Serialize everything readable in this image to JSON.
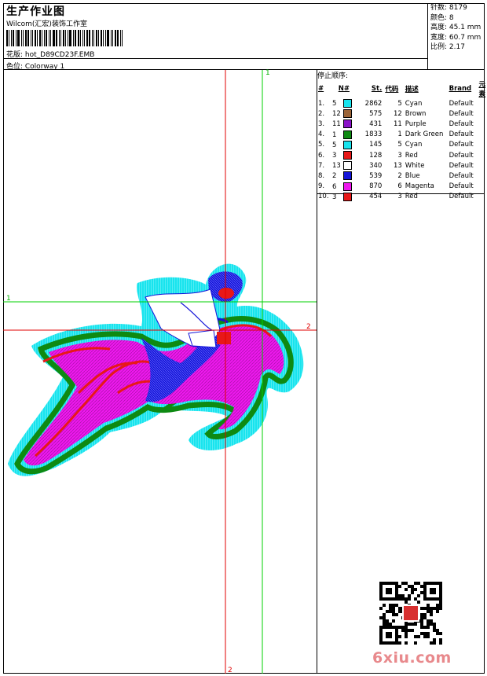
{
  "header": {
    "title": "生产作业图",
    "company": "Wilcom(汇宏)装饰工作室",
    "design_label": "花版: hot_D89CD23F.EMB",
    "colorway_label": "色位: Colorway 1"
  },
  "stats": [
    "针数: 8179",
    "颜色: 8",
    "高度: 45.1 mm",
    "宽度: 60.7 mm",
    "比例: 2.17"
  ],
  "stop_sequence": {
    "title": "停止顺序:",
    "headers": [
      "#",
      "N#",
      "St.",
      "代码",
      "描述",
      "Brand",
      "元素"
    ],
    "rows": [
      {
        "idx": "1.",
        "n": "5",
        "color": "#18e4ee",
        "st": "2862",
        "code": "5",
        "desc": "Cyan",
        "brand": "Default"
      },
      {
        "idx": "2.",
        "n": "12",
        "color": "#9a6438",
        "st": "575",
        "code": "12",
        "desc": "Brown",
        "brand": "Default"
      },
      {
        "idx": "3.",
        "n": "11",
        "color": "#8a12c8",
        "st": "431",
        "code": "11",
        "desc": "Purple",
        "brand": "Default"
      },
      {
        "idx": "4.",
        "n": "1",
        "color": "#0e8a12",
        "st": "1833",
        "code": "1",
        "desc": "Dark Green",
        "brand": "Default"
      },
      {
        "idx": "5.",
        "n": "5",
        "color": "#18e4ee",
        "st": "145",
        "code": "5",
        "desc": "Cyan",
        "brand": "Default"
      },
      {
        "idx": "6.",
        "n": "3",
        "color": "#e81818",
        "st": "128",
        "code": "3",
        "desc": "Red",
        "brand": "Default"
      },
      {
        "idx": "7.",
        "n": "13",
        "color": "#ffffff",
        "st": "340",
        "code": "13",
        "desc": "White",
        "brand": "Default"
      },
      {
        "idx": "8.",
        "n": "2",
        "color": "#1414d8",
        "st": "539",
        "code": "2",
        "desc": "Blue",
        "brand": "Default"
      },
      {
        "idx": "9.",
        "n": "6",
        "color": "#ee18ee",
        "st": "870",
        "code": "6",
        "desc": "Magenta",
        "brand": "Default"
      },
      {
        "idx": "10.",
        "n": "3",
        "color": "#e81818",
        "st": "454",
        "code": "3",
        "desc": "Red",
        "brand": "Default"
      }
    ]
  },
  "guides": {
    "green_v": "1",
    "green_h": "1",
    "red_h": "2",
    "red_v": "2"
  },
  "watermark": "6xiu.com",
  "colors": {
    "cyan": "#18e4ee",
    "green": "#0e8a12",
    "magenta": "#ee18ee",
    "red": "#e81818",
    "blue": "#1414d8",
    "purple": "#8a12c8",
    "guide_green": "#00d000",
    "guide_red": "#e00000"
  }
}
